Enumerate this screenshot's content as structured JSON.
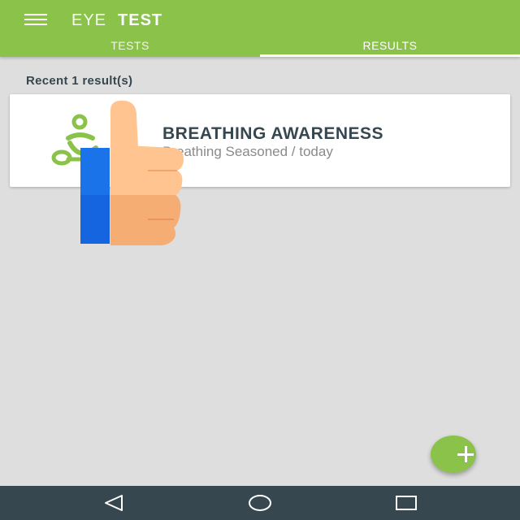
{
  "app_bar": {
    "title_light": "EYE",
    "title_bold": "TEST",
    "color": "#8bc34a",
    "menu_icon": "hamburger-menu-icon"
  },
  "tabs": [
    {
      "label": "TESTS",
      "selected": false
    },
    {
      "label": "RESULTS",
      "selected": true
    }
  ],
  "results": {
    "header": "Recent 1 result(s)",
    "items": [
      {
        "title": "BREATHING AWARENESS",
        "subtitle": "Breathing Seasoned / today",
        "icon": "meditation-figure-icon"
      }
    ]
  },
  "overlay": {
    "icon": "thumbs-up-icon"
  },
  "fab": {
    "icon": "plus-icon",
    "color": "#8bc34a"
  },
  "system_nav": {
    "back_icon": "back-triangle-icon",
    "home_icon": "home-circle-icon",
    "recents_icon": "recents-square-icon",
    "color": "#37474f"
  }
}
